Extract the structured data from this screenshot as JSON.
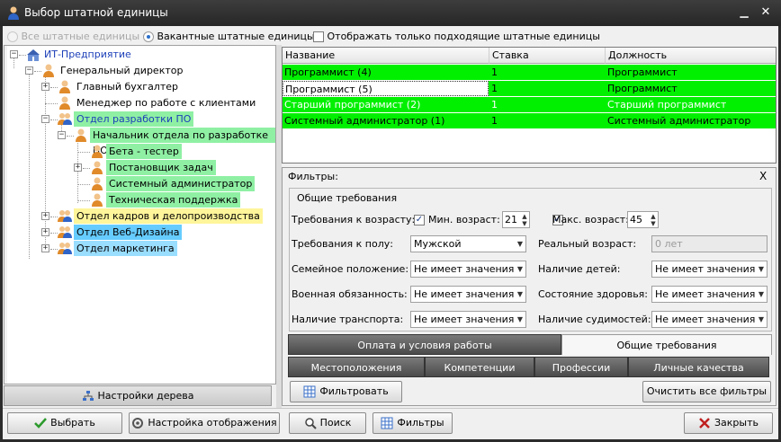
{
  "window": {
    "title": "Выбор штатной единицы"
  },
  "options": {
    "all_units": "Все штатные единицы",
    "vacant_units": "Вакантные штатные единицы",
    "only_matching": "Отображать только подходящие штатные единицы"
  },
  "tree": {
    "root": "ИТ-Предприятие",
    "director": "Генеральный директор",
    "chief_accountant": "Главный бухгалтер",
    "client_manager": "Менеджер по работе с клиентами",
    "dev_department": "Отдел разработки ПО",
    "dev_head": "Начальник отдела по разработке ПО",
    "beta_tester": "Бета - тестер",
    "task_setter": "Постановщик задач",
    "sysadmin": "Системный администратор",
    "support": "Техническая поддержка",
    "hr_department": "Отдел кадров и делопроизводства",
    "web_department": "Отдел Веб-Дизайна",
    "marketing_department": "Отдел маркетинга",
    "settings_button": "Настройки дерева"
  },
  "grid": {
    "columns": [
      "Название",
      "Ставка",
      "Должность"
    ],
    "rows": [
      {
        "name": "Программист (4)",
        "rate": "1",
        "position": "Программист"
      },
      {
        "name": "Программист (5)",
        "rate": "1",
        "position": "Программист"
      },
      {
        "name": "Старший программист (2)",
        "rate": "1",
        "position": "Старший программист"
      },
      {
        "name": "Системный администратор (1)",
        "rate": "1",
        "position": "Системный администратор"
      }
    ]
  },
  "filters": {
    "title": "Фильтры:",
    "close": "X",
    "group_title": "Общие требования",
    "age_req": "Требования к возрасту:",
    "min_age_label": "Мин. возраст:",
    "min_age": "21",
    "max_age_label": "Макс. возраст:",
    "max_age": "45",
    "gender_req": "Требования к полу:",
    "gender": "Мужской",
    "real_age_label": "Реальный возраст:",
    "real_age_placeholder": "0 лет",
    "family_label": "Семейное положение:",
    "family": "Не имеет значения",
    "children_label": "Наличие детей:",
    "children": "Не имеет значения",
    "military_label": "Военная обязанность:",
    "military": "Не имеет значения",
    "health_label": "Состояние здоровья:",
    "health": "Не имеет значения",
    "transport_label": "Наличие транспорта:",
    "transport": "Не имеет значения",
    "criminal_label": "Наличие судимостей:",
    "criminal": "Не имеет значения",
    "tabs_row1": [
      "Оплата и условия работы",
      "Общие требования"
    ],
    "tabs_row2": [
      "Местоположения",
      "Компетенции",
      "Профессии",
      "Личные качества"
    ],
    "filter_button": "Фильтровать",
    "clear_button": "Очистить все фильтры"
  },
  "buttons": {
    "select": "Выбрать",
    "display_settings": "Настройка отображения",
    "search": "Поиск",
    "filters": "Фильтры",
    "close": "Закрыть"
  },
  "colors": {
    "vacant_green": "#00f000",
    "selection_blue": "#3399ff",
    "dev_dept_highlight": "#8ff0a4",
    "hr_dept_highlight": "#fff59a",
    "web_dept_highlight": "#66ccff",
    "marketing_dept_highlight": "#99ddff"
  },
  "icons": [
    "person-icon",
    "group-icon",
    "company-icon",
    "tree-settings-icon",
    "check-icon",
    "settings-icon",
    "search-icon",
    "filter-icon",
    "close-x-icon"
  ]
}
